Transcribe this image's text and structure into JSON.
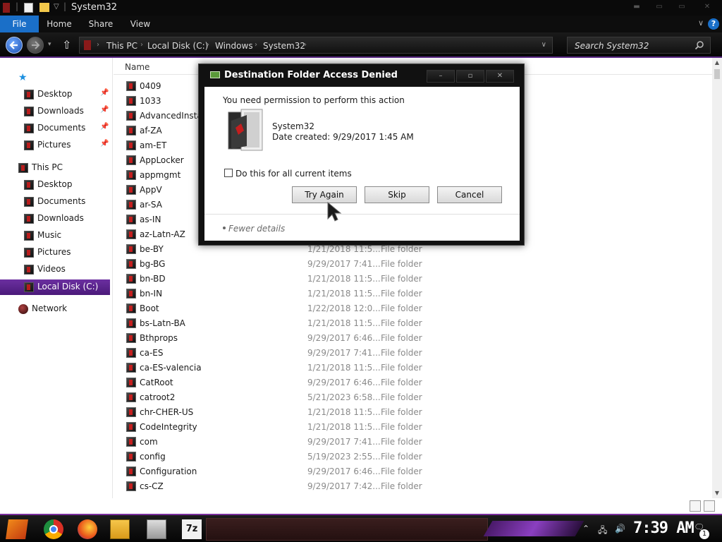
{
  "window": {
    "title": "System32"
  },
  "ribbon": {
    "tabs": [
      "File",
      "Home",
      "Share",
      "View"
    ],
    "help": "?"
  },
  "addressbar": {
    "crumbs": [
      "This PC",
      "Local Disk (C:)",
      "Windows",
      "System32"
    ],
    "search_placeholder": "Search System32"
  },
  "sidebar": {
    "quick_access": "",
    "quick_items": [
      "Desktop",
      "Downloads",
      "Documents",
      "Pictures"
    ],
    "this_pc": "This PC",
    "pc_items": [
      "Desktop",
      "Documents",
      "Downloads",
      "Music",
      "Pictures",
      "Videos",
      "Local Disk (C:)"
    ],
    "network": "Network",
    "selected": "Local Disk (C:)"
  },
  "filelist": {
    "columns": {
      "name": "Name"
    },
    "rows": [
      {
        "name": "0409",
        "date": "",
        "type": ""
      },
      {
        "name": "1033",
        "date": "",
        "type": ""
      },
      {
        "name": "AdvancedInstallers",
        "date": "",
        "type": ""
      },
      {
        "name": "af-ZA",
        "date": "",
        "type": ""
      },
      {
        "name": "am-ET",
        "date": "",
        "type": ""
      },
      {
        "name": "AppLocker",
        "date": "",
        "type": ""
      },
      {
        "name": "appmgmt",
        "date": "",
        "type": ""
      },
      {
        "name": "AppV",
        "date": "",
        "type": ""
      },
      {
        "name": "ar-SA",
        "date": "",
        "type": ""
      },
      {
        "name": "as-IN",
        "date": "",
        "type": ""
      },
      {
        "name": "az-Latn-AZ",
        "date": "",
        "type": ""
      },
      {
        "name": "be-BY",
        "date": "1/21/2018 11:5...",
        "type": "File folder"
      },
      {
        "name": "bg-BG",
        "date": "9/29/2017 7:41...",
        "type": "File folder"
      },
      {
        "name": "bn-BD",
        "date": "1/21/2018 11:5...",
        "type": "File folder"
      },
      {
        "name": "bn-IN",
        "date": "1/21/2018 11:5...",
        "type": "File folder"
      },
      {
        "name": "Boot",
        "date": "1/22/2018 12:0...",
        "type": "File folder"
      },
      {
        "name": "bs-Latn-BA",
        "date": "1/21/2018 11:5...",
        "type": "File folder"
      },
      {
        "name": "Bthprops",
        "date": "9/29/2017 6:46...",
        "type": "File folder"
      },
      {
        "name": "ca-ES",
        "date": "9/29/2017 7:41...",
        "type": "File folder"
      },
      {
        "name": "ca-ES-valencia",
        "date": "1/21/2018 11:5...",
        "type": "File folder"
      },
      {
        "name": "CatRoot",
        "date": "9/29/2017 6:46...",
        "type": "File folder"
      },
      {
        "name": "catroot2",
        "date": "5/21/2023 6:58...",
        "type": "File folder"
      },
      {
        "name": "chr-CHER-US",
        "date": "1/21/2018 11:5...",
        "type": "File folder"
      },
      {
        "name": "CodeIntegrity",
        "date": "1/21/2018 11:5...",
        "type": "File folder"
      },
      {
        "name": "com",
        "date": "9/29/2017 7:41...",
        "type": "File folder"
      },
      {
        "name": "config",
        "date": "5/19/2023 2:55...",
        "type": "File folder"
      },
      {
        "name": "Configuration",
        "date": "9/29/2017 6:46...",
        "type": "File folder"
      },
      {
        "name": "cs-CZ",
        "date": "9/29/2017 7:42...",
        "type": "File folder"
      }
    ]
  },
  "dialog": {
    "title": "Destination Folder Access Denied",
    "message": "You need permission to perform this action",
    "item_name": "System32",
    "item_date": "Date created: 9/29/2017 1:45 AM",
    "checkbox_label": "Do this for all current items",
    "buttons": {
      "try_again": "Try Again",
      "skip": "Skip",
      "cancel": "Cancel"
    },
    "fewer_details": "Fewer details"
  },
  "taskbar": {
    "clock": "7:39 AM",
    "notification_count": "1"
  },
  "colors": {
    "accent": "#6b2fa0",
    "file_tab": "#1a6fc8",
    "icon_red": "#c41e1e"
  }
}
